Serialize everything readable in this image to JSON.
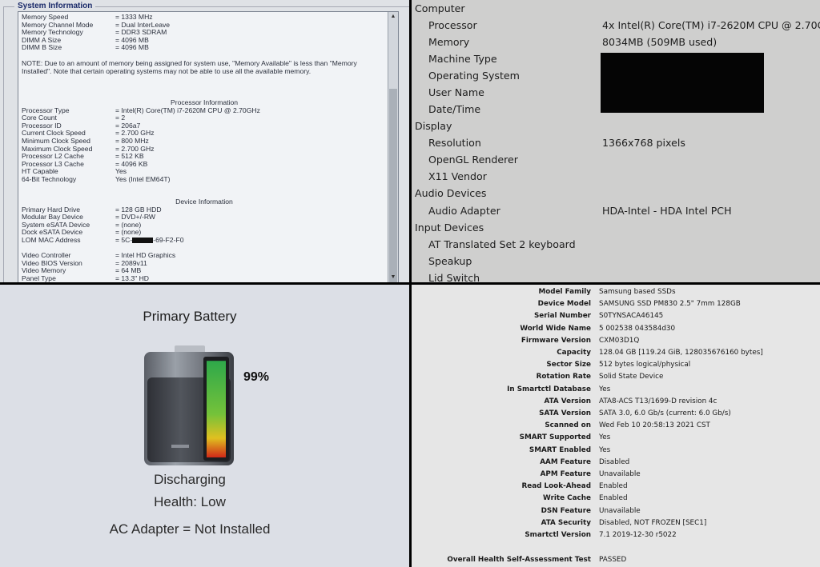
{
  "bios": {
    "section_title": "System Information",
    "memory_rows": [
      {
        "k": "Memory Speed",
        "v": "= 1333 MHz"
      },
      {
        "k": "Memory Channel Mode",
        "v": "= Dual InterLeave"
      },
      {
        "k": "Memory Technology",
        "v": "= DDR3 SDRAM"
      },
      {
        "k": "DIMM A Size",
        "v": "= 4096 MB"
      },
      {
        "k": "DIMM B Size",
        "v": "= 4096 MB"
      }
    ],
    "note": "NOTE: Due to an amount of memory being assigned for system use, \"Memory Available\" is less than \"Memory Installed\". Note that certain operating systems may not be able to use all the available memory.",
    "processor_title": "Processor Information",
    "processor_rows": [
      {
        "k": "Processor Type",
        "v": "= Intel(R) Core(TM) i7-2620M CPU @ 2.70GHz"
      },
      {
        "k": "Core Count",
        "v": "= 2"
      },
      {
        "k": "Processor ID",
        "v": "= 206a7"
      },
      {
        "k": "Current Clock Speed",
        "v": "= 2.700 GHz"
      },
      {
        "k": "Minimum Clock Speed",
        "v": "= 800 MHz"
      },
      {
        "k": "Maximum Clock Speed",
        "v": "= 2.700 GHz"
      },
      {
        "k": "Processor L2 Cache",
        "v": "= 512 KB"
      },
      {
        "k": "Processor L3 Cache",
        "v": "= 4096 KB"
      },
      {
        "k": "HT Capable",
        "v": "Yes"
      },
      {
        "k": "64-Bit Technology",
        "v": "Yes (Intel EM64T)"
      }
    ],
    "device_title": "Device Information",
    "device_rows": [
      {
        "k": "Primary Hard Drive",
        "v": "= 128 GB HDD"
      },
      {
        "k": "Modular Bay Device",
        "v": "= DVD+/-RW"
      },
      {
        "k": "System eSATA Device",
        "v": "= (none)"
      },
      {
        "k": "Dock eSATA Device",
        "v": "= (none)"
      }
    ],
    "mac_label": "LOM MAC Address",
    "mac_prefix": "= 5C-",
    "mac_suffix": "-69-F2-F0",
    "video_rows": [
      {
        "k": "Video Controller",
        "v": "= Intel HD Graphics"
      },
      {
        "k": "Video BIOS Version",
        "v": "= 2089v11"
      },
      {
        "k": "Video Memory",
        "v": "= 64 MB"
      },
      {
        "k": "Panel Type",
        "v": "= 13.3\" HD"
      }
    ]
  },
  "hardinfo": {
    "computer": "Computer",
    "processor_label": "Processor",
    "processor_value": "4x Intel(R) Core(TM) i7-2620M CPU @ 2.70GHz",
    "memory_label": "Memory",
    "memory_value": "8034MB (509MB used)",
    "machine_type": "Machine Type",
    "operating_system": "Operating System",
    "user_name": "User Name",
    "date_time": "Date/Time",
    "display": "Display",
    "resolution_label": "Resolution",
    "resolution_value": "1366x768 pixels",
    "opengl": "OpenGL Renderer",
    "x11": "X11 Vendor",
    "audio_devices": "Audio Devices",
    "audio_adapter_label": "Audio Adapter",
    "audio_adapter_value": "HDA-Intel - HDA Intel PCH",
    "input_devices": "Input Devices",
    "keyboard": "AT Translated Set 2 keyboard",
    "speakup": "Speakup",
    "lid_switch": "Lid Switch"
  },
  "battery": {
    "title": "Primary Battery",
    "percent_text": "99%",
    "charge_fraction": 0.99,
    "status": "Discharging",
    "health": "Health: Low",
    "ac_adapter": "AC Adapter = Not Installed"
  },
  "smart": {
    "rows": [
      {
        "k": "Model Family",
        "v": "Samsung based SSDs"
      },
      {
        "k": "Device Model",
        "v": "SAMSUNG SSD PM830 2.5\" 7mm 128GB"
      },
      {
        "k": "Serial Number",
        "v": "S0TYNSACA46145"
      },
      {
        "k": "World Wide Name",
        "v": "5 002538 043584d30"
      },
      {
        "k": "Firmware Version",
        "v": "CXM03D1Q"
      },
      {
        "k": "Capacity",
        "v": "128.04 GB [119.24 GiB, 128035676160 bytes]"
      },
      {
        "k": "Sector Size",
        "v": "512 bytes logical/physical"
      },
      {
        "k": "Rotation Rate",
        "v": "Solid State Device"
      },
      {
        "k": "In Smartctl Database",
        "v": "Yes"
      },
      {
        "k": "ATA Version",
        "v": "ATA8-ACS T13/1699-D revision 4c"
      },
      {
        "k": "SATA Version",
        "v": "SATA 3.0, 6.0 Gb/s (current: 6.0 Gb/s)"
      },
      {
        "k": "Scanned on",
        "v": "Wed Feb 10 20:58:13 2021 CST"
      },
      {
        "k": "SMART Supported",
        "v": "Yes"
      },
      {
        "k": "SMART Enabled",
        "v": "Yes"
      },
      {
        "k": "AAM Feature",
        "v": "Disabled"
      },
      {
        "k": "APM Feature",
        "v": "Unavailable"
      },
      {
        "k": "Read Look-Ahead",
        "v": "Enabled"
      },
      {
        "k": "Write Cache",
        "v": "Enabled"
      },
      {
        "k": "DSN Feature",
        "v": "Unavailable"
      },
      {
        "k": "ATA Security",
        "v": "Disabled, NOT FROZEN [SEC1]"
      },
      {
        "k": "Smartctl Version",
        "v": "7.1 2019-12-30 r5022"
      }
    ],
    "health_label": "Overall Health Self-Assessment Test",
    "health_value": "PASSED"
  }
}
